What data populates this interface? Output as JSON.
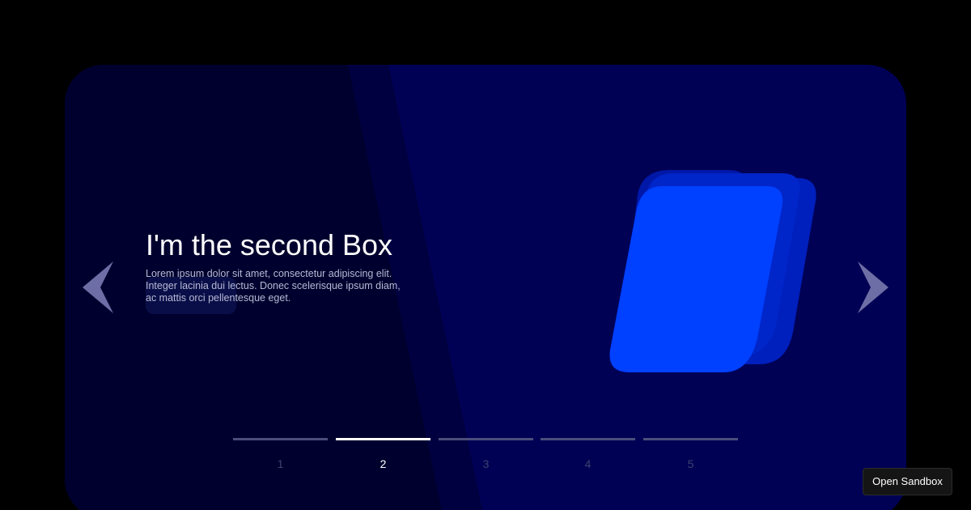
{
  "colors": {
    "page_background": "#000000",
    "card_background": "#000055",
    "dark_panel": "#00002e",
    "box_front": "#0040ff",
    "box_middle": "#0025c8",
    "box_back": "#0018a8",
    "pager_inactive": "#4b4d7a",
    "pager_active": "#ffffff"
  },
  "slide": {
    "title": "I'm the second Box",
    "text": "Lorem ipsum dolor sit amet, consectetur adipiscing elit. Integer lacinia dui lectus. Donec scelerisque ipsum diam, ac mattis orci pellentesque eget."
  },
  "navigation": {
    "prev_icon": "chevron-left-icon",
    "next_icon": "chevron-right-icon"
  },
  "pager": {
    "active_index": 1,
    "items": [
      {
        "label": "1"
      },
      {
        "label": "2"
      },
      {
        "label": "3"
      },
      {
        "label": "4"
      },
      {
        "label": "5"
      }
    ]
  },
  "sandbox_button": {
    "label": "Open Sandbox"
  }
}
